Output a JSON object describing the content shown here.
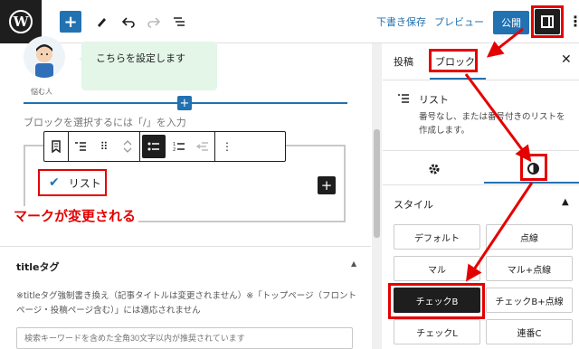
{
  "toolbar": {
    "wp_logo": "W",
    "save_draft": "下書き保存",
    "preview": "プレビュー",
    "publish": "公開"
  },
  "editor": {
    "avatar_caption": "悩む人",
    "balloon_text": "こちらを設定します",
    "placeholder": "ブロックを選択するには「/」を入力",
    "list_item_text": "リスト",
    "annotation": "マークが変更される"
  },
  "meta": {
    "heading": "titleタグ",
    "description": "※titleタグ強制書き換え（記事タイトルは変更されません）※「トップページ（フロントページ・投稿ページ含む）」には適応されません",
    "input_placeholder": "検索キーワードを含めた全角30文字以内が推奨されています"
  },
  "sidebar": {
    "tab_post": "投稿",
    "tab_block": "ブロック",
    "block_title": "リスト",
    "block_desc": "番号なし、または番号付きのリストを作成します。",
    "style_heading": "スタイル",
    "styles": [
      "デフォルト",
      "点線",
      "マル",
      "マル+点線",
      "チェックB",
      "チェックB+点線",
      "チェックL",
      "連番C"
    ],
    "selected_style": "チェックB"
  },
  "colors": {
    "accent": "#2271b1",
    "annotation_red": "#e50000",
    "dark": "#1e1e1e"
  }
}
